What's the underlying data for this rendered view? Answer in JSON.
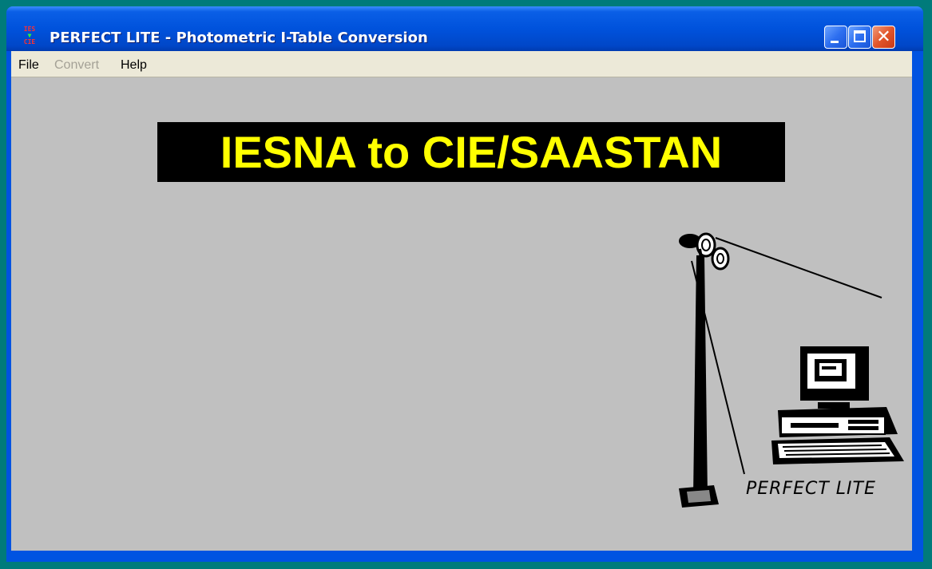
{
  "window": {
    "title": "PERFECT LITE - Photometric I-Table Conversion",
    "app_icon_lines": [
      "IES",
      "▼",
      "CIE"
    ]
  },
  "menu": {
    "file": "File",
    "convert": "Convert",
    "help": "Help"
  },
  "banner": {
    "text": "IESNA to CIE/SAASTAN",
    "text_color": "#ffff00",
    "background": "#000000"
  },
  "illustration": {
    "logo_text": "PERFECT LITE",
    "icons": [
      "floodlight-pole",
      "computer"
    ]
  },
  "colors": {
    "desktop": "#007b7b",
    "titlebar": "#0052dc",
    "client": "#c0c0c0",
    "menubar": "#ece9d8"
  }
}
